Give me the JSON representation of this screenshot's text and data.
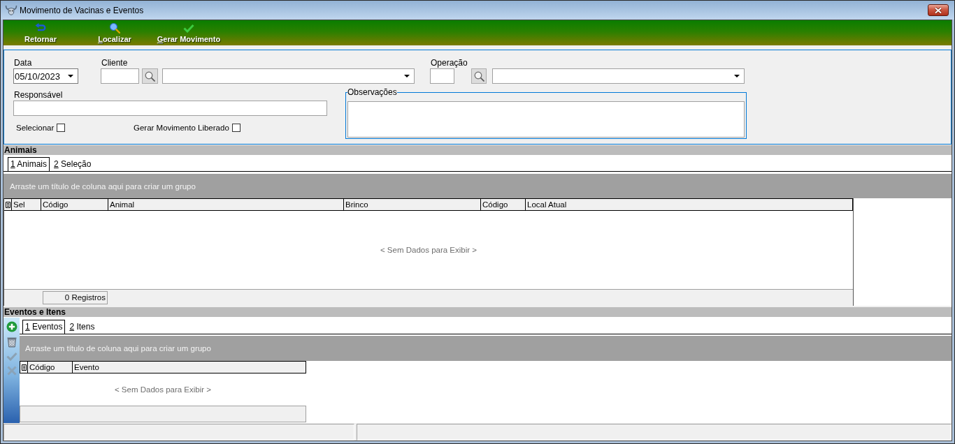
{
  "window": {
    "title": "Movimento de Vacinas e Eventos"
  },
  "toolbar": [
    {
      "kind": "return",
      "label": "Retornar",
      "mnemonic": false
    },
    {
      "kind": "search",
      "label": "Localizar",
      "mnemonic": true
    },
    {
      "kind": "check",
      "label": "Gerar Movimento",
      "mnemonic": true
    }
  ],
  "form": {
    "date": {
      "label": "Data",
      "value": "05/10/2023"
    },
    "client": {
      "label": "Cliente"
    },
    "operation": {
      "label": "Operação"
    },
    "responsible": {
      "label": "Responsável"
    },
    "checkboxes": [
      {
        "label": "Selecionar",
        "checked": false
      },
      {
        "label": "Gerar Movimento Liberado",
        "checked": false
      }
    ],
    "notes": {
      "label": "Observações"
    }
  },
  "animals_panel": {
    "title": "Animais",
    "tabs": [
      {
        "label": "1 Animais",
        "selected": true,
        "mnemonic": true
      },
      {
        "label": "2 Seleção",
        "selected": false,
        "mnemonic": true
      }
    ],
    "grid": {
      "group_hint": "Arraste um título de coluna aqui para criar um grupo",
      "columns": [
        "Sel",
        "Código",
        "Animal",
        "Brinco",
        "Código",
        "Local Atual"
      ],
      "empty_text": "< Sem Dados para Exibir >",
      "record_count": "0 Registros"
    }
  },
  "events_panel": {
    "title": "Eventos e Itens",
    "side_tools": [
      {
        "kind": "add",
        "disabled": false
      },
      {
        "kind": "delete",
        "disabled": false
      },
      {
        "kind": "confirm",
        "disabled": true
      },
      {
        "kind": "cancel",
        "disabled": true
      }
    ],
    "tabs": [
      {
        "label": "1 Eventos",
        "selected": true,
        "mnemonic": true
      },
      {
        "label": "2 Itens",
        "selected": false,
        "mnemonic": true
      }
    ],
    "grid": {
      "group_hint": "Arraste um título de coluna aqui para criar um grupo",
      "columns": [
        "Código",
        "Evento"
      ],
      "empty_text": "< Sem Dados para Exibir >"
    }
  }
}
